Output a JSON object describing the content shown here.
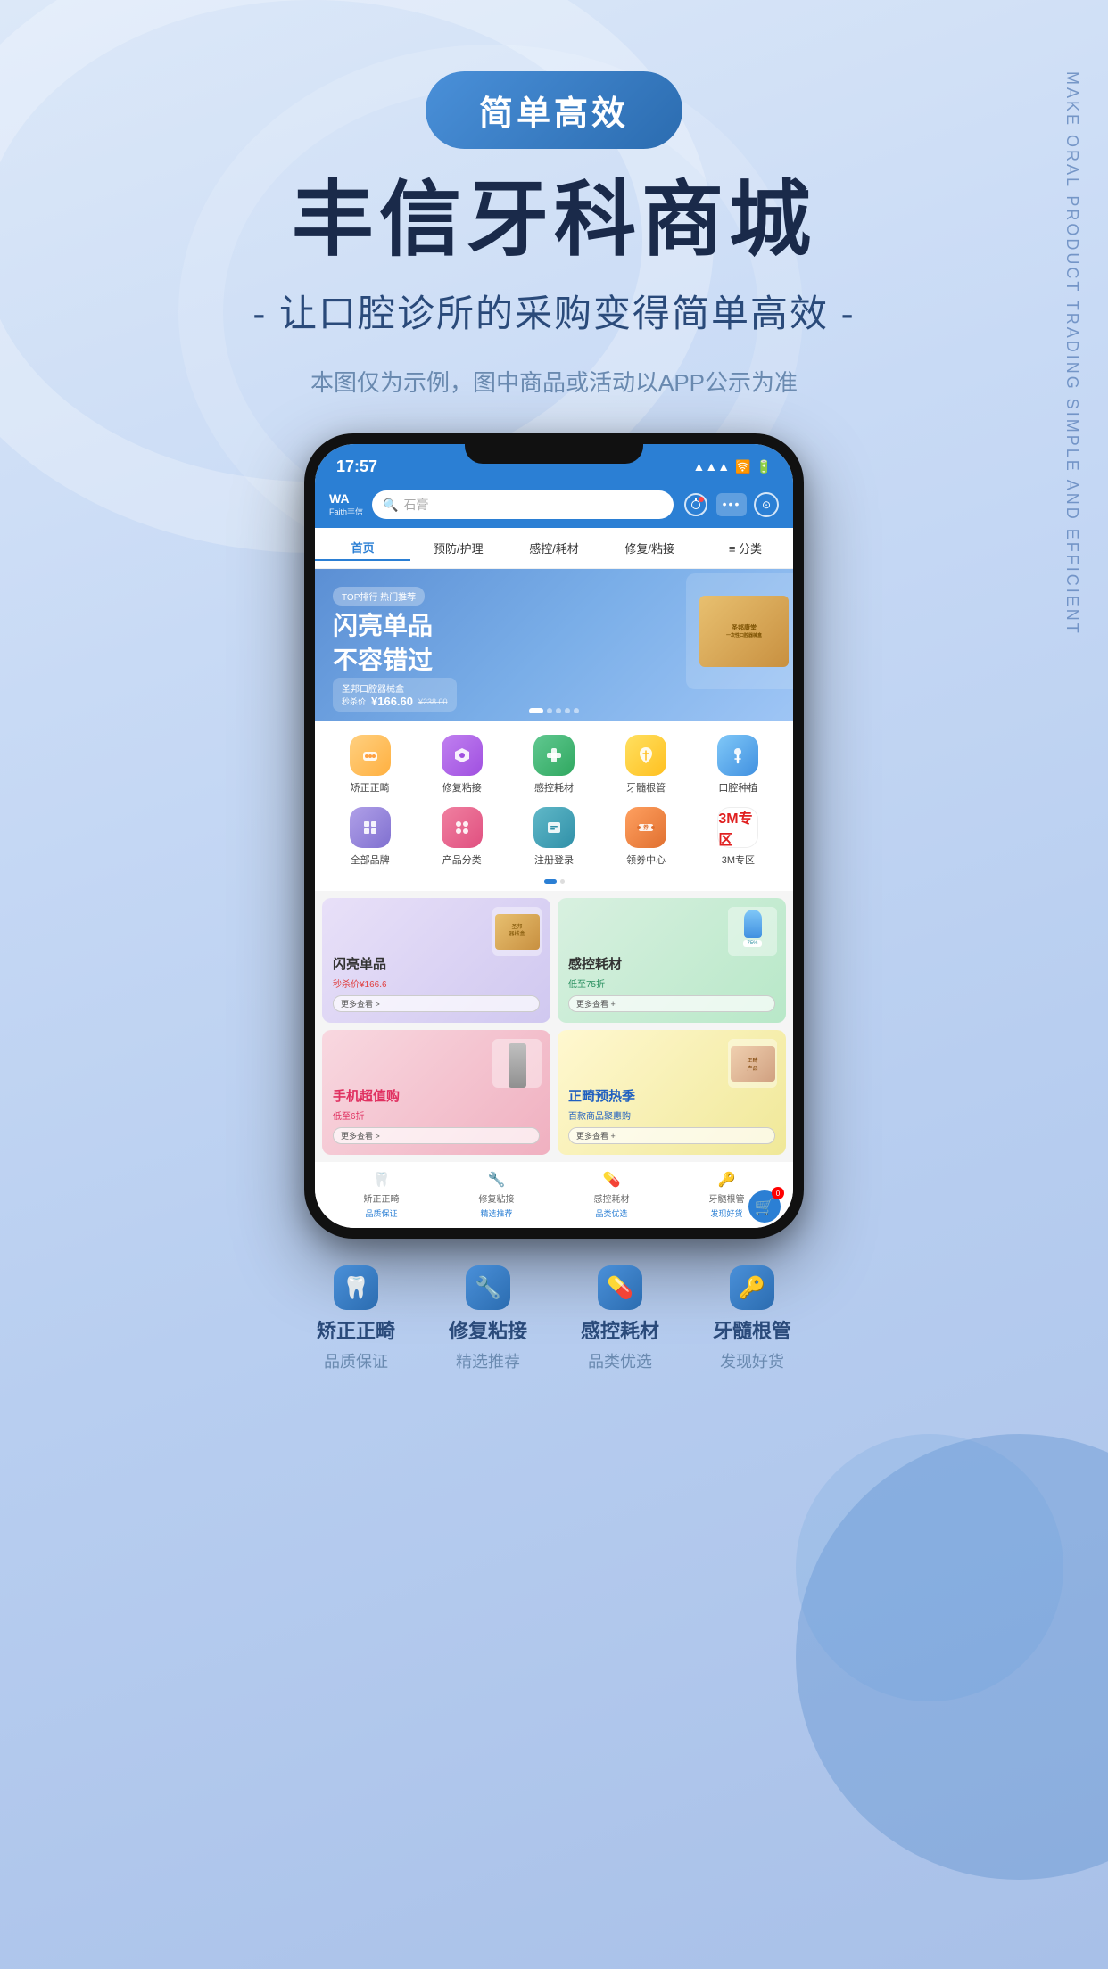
{
  "page": {
    "bg_side_text": "MAKE ORAL PRODUCT TRADING SIMPLE AND EFFICIENT",
    "tag_badge": "简单高效",
    "main_title": "丰信牙科商城",
    "sub_title": "- 让口腔诊所的采购变得简单高效 -",
    "note": "本图仅为示例，图中商品或活动以APP公示为准"
  },
  "phone": {
    "status_bar": {
      "time": "17:57",
      "signal": "▲▲▲",
      "wifi": "wifi",
      "battery": "battery"
    },
    "header": {
      "logo_wa": "WA",
      "logo_name": "Faith丰信",
      "search_placeholder": "石膏",
      "icon1": "🔔",
      "icon2": "•••",
      "icon3": "⊙"
    },
    "nav": {
      "items": [
        {
          "label": "首页",
          "active": true
        },
        {
          "label": "预防/护理",
          "active": false
        },
        {
          "label": "感控/耗材",
          "active": false
        },
        {
          "label": "修复/粘接",
          "active": false
        },
        {
          "label": "≡ 分类",
          "active": false
        }
      ]
    },
    "banner": {
      "tag": "TOP排行 热门推荐",
      "text1": "闪亮单品",
      "text2": "不容错过",
      "product": "圣邦口腔器械盒",
      "price": "¥166.60",
      "original_price": "¥238.00",
      "price_label": "秒杀价",
      "dots": [
        true,
        false,
        false,
        false,
        false
      ]
    },
    "categories": {
      "row1": [
        {
          "label": "矫正正畸",
          "color": "orange",
          "emoji": "🦷"
        },
        {
          "label": "修复粘接",
          "color": "purple",
          "emoji": "🔧"
        },
        {
          "label": "感控耗材",
          "color": "green",
          "emoji": "💊"
        },
        {
          "label": "牙髓根管",
          "color": "yellow",
          "emoji": "🔑"
        },
        {
          "label": "口腔种植",
          "color": "blue2",
          "emoji": "💡"
        }
      ],
      "row2": [
        {
          "label": "全部品牌",
          "color": "lavender",
          "emoji": "🏷"
        },
        {
          "label": "产品分类",
          "color": "pink",
          "emoji": "❋"
        },
        {
          "label": "注册登录",
          "color": "teal",
          "emoji": "🖥"
        },
        {
          "label": "领券中心",
          "color": "light-orange",
          "emoji": "🎫"
        },
        {
          "label": "3M专区",
          "color": "red3m",
          "emoji": "3M"
        }
      ]
    },
    "promos": [
      {
        "title": "闪亮单品",
        "subtitle": "秒杀价¥166.6",
        "btn": "更多查看 >"
      },
      {
        "title": "感控耗材",
        "subtitle": "低至75折",
        "btn": "更多查看 +"
      },
      {
        "title": "手机超值购",
        "subtitle": "低至6折",
        "btn": "更多查看 >"
      },
      {
        "title": "正畸预热季",
        "subtitle": "百款商品聚惠购",
        "btn": "更多查看 +"
      }
    ],
    "bottom_nav": [
      {
        "label": "矫正正畸",
        "sub": "品质保证",
        "icon": "🦷"
      },
      {
        "label": "修复粘接",
        "sub": "精选推荐",
        "icon": "🔧"
      },
      {
        "label": "感控耗材",
        "sub": "品类优选",
        "icon": "💊"
      },
      {
        "label": "牙髓根管",
        "sub": "发现好货",
        "icon": "🔑"
      }
    ]
  },
  "footer": {
    "badges": [
      {
        "icon": "🦷",
        "label": "矫正正畸",
        "sub": "品质保证"
      },
      {
        "icon": "🔧",
        "label": "修复粘接",
        "sub": "精选推荐"
      },
      {
        "icon": "💊",
        "label": "感控耗材",
        "sub": "品类优选"
      },
      {
        "icon": "🔑",
        "label": "牙髓根管",
        "sub": "发现好货"
      }
    ]
  }
}
